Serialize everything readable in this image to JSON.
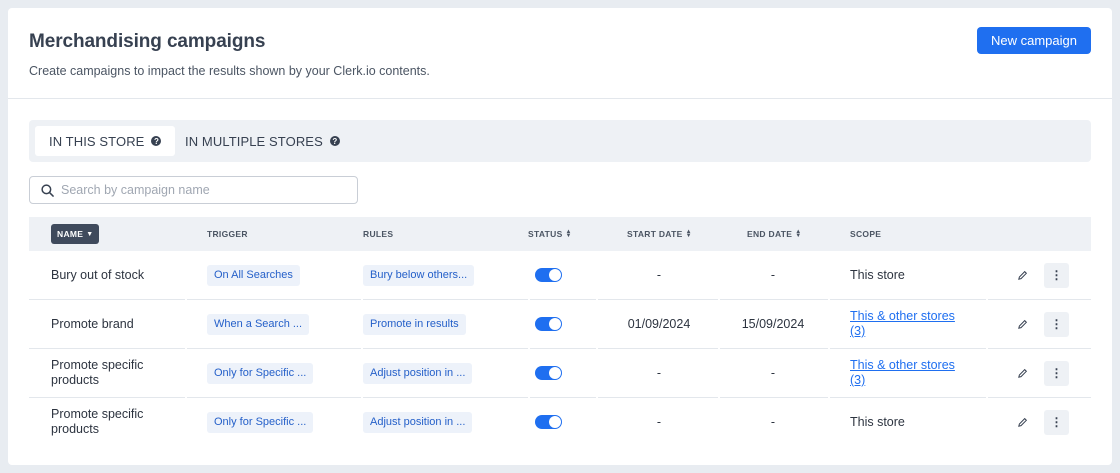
{
  "header": {
    "title": "Merchandising campaigns",
    "subtitle": "Create campaigns to impact the results shown by your Clerk.io contents.",
    "new_campaign_label": "New campaign"
  },
  "tabs": [
    {
      "label": "IN THIS STORE",
      "active": true,
      "help_icon": "question-circle-icon"
    },
    {
      "label": "IN MULTIPLE STORES",
      "active": false,
      "help_icon": "question-circle-icon"
    }
  ],
  "search": {
    "placeholder": "Search by campaign name",
    "value": ""
  },
  "table": {
    "columns": {
      "name": "NAME",
      "trigger": "TRIGGER",
      "rules": "RULES",
      "status": "STATUS",
      "start_date": "START DATE",
      "end_date": "END DATE",
      "scope": "SCOPE"
    },
    "rows": [
      {
        "name": "Bury out of stock",
        "trigger": "On All Searches",
        "rules": "Bury below others...",
        "status": "on",
        "start_date": "-",
        "end_date": "-",
        "scope": "This store",
        "scope_link": false
      },
      {
        "name": "Promote brand",
        "trigger": "When a Search ...",
        "rules": "Promote in results",
        "status": "on",
        "start_date": "01/09/2024",
        "end_date": "15/09/2024",
        "scope": "This & other stores (3)",
        "scope_link": true
      },
      {
        "name": "Promote specific products",
        "trigger": "Only for Specific ...",
        "rules": "Adjust position in ...",
        "status": "on",
        "start_date": "-",
        "end_date": "-",
        "scope": "This & other stores (3)",
        "scope_link": true
      },
      {
        "name": "Promote specific products",
        "trigger": "Only for Specific ...",
        "rules": "Adjust position in ...",
        "status": "on",
        "start_date": "-",
        "end_date": "-",
        "scope": "This store",
        "scope_link": false
      }
    ]
  },
  "colors": {
    "accent": "#1f6ff0",
    "header_bg": "#eef1f5",
    "pill_dark": "#3f4a5c",
    "tag_bg": "#edf2fa",
    "tag_text": "#2560c9"
  }
}
